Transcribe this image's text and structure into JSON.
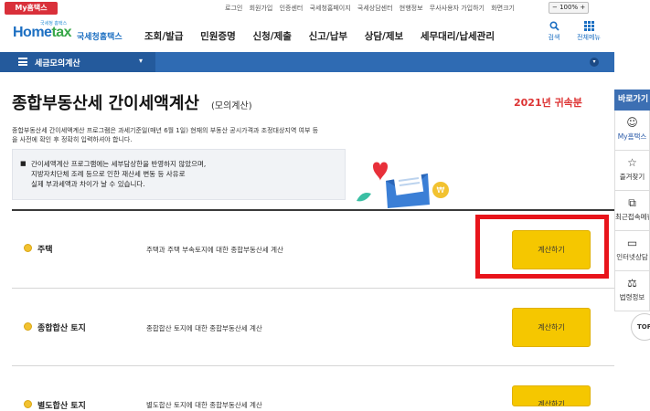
{
  "topbar": {
    "my_tab": "My홈택스",
    "links": [
      "로그인",
      "회원가입",
      "인증센터",
      "국세청홈페이지",
      "국세상담센터",
      "현행정보",
      "무사사용자 가입하기",
      "화면크기"
    ],
    "zoom": "100%"
  },
  "header": {
    "logo_tiny": "국세청 홈택스",
    "logo_home": "Home",
    "logo_tax": "tax",
    "logo_kr": "국세청홈택스",
    "nav": [
      "조회/발급",
      "민원증명",
      "신청/제출",
      "신고/납부",
      "상담/제보",
      "세무대리/납세관리"
    ],
    "search_label": "검색",
    "allmenu_label": "전체메뉴"
  },
  "navbar": {
    "title": "세금모의계산",
    "caret": "▾"
  },
  "main": {
    "title": "종합부동산세 간이세액계산",
    "subtitle": "(모의계산)",
    "year": "2021년 귀속분",
    "description": "종합부동산세 간이세액계산 프로그램은 과세기준일(매년 6월 1일) 현재의 부동산 공시가격과 조정대상지역 여부 등을 사전에 확인 후 정확히 입력하셔야 합니다.",
    "notice_lines": [
      "간이세액계산 프로그램에는 세부담상한을 반영하지 않았으며,",
      "지방자치단체 조례 등으로 인한 재산세 변동 등 사유로",
      "실제 부과세액과 차이가 날 수 있습니다."
    ],
    "rows": [
      {
        "name": "주택",
        "desc": "주택과 주택 부속토지에 대한 종합부동산세 계산",
        "button": "계산하기"
      },
      {
        "name": "종합합산 토지",
        "desc": "종합합산 토지에 대한 종합부동산세 계산",
        "button": "계산하기"
      },
      {
        "name": "별도합산 토지",
        "desc": "별도합산 토지에 대한 종합부동산세 계산",
        "button": "계산하기"
      }
    ]
  },
  "sidebar": {
    "heading": "바로가기",
    "items": [
      {
        "icon": "user-icon",
        "label": "My홈택스"
      },
      {
        "icon": "star-icon",
        "label": "즐겨찾기"
      },
      {
        "icon": "history-icon",
        "label": "최근접속메뉴"
      },
      {
        "icon": "monitor-icon",
        "label": "인터넷상담"
      },
      {
        "icon": "gavel-icon",
        "label": "법령정보"
      }
    ],
    "top_button": "TOP"
  },
  "colors": {
    "accent_blue": "#2f6bb3",
    "button_yellow": "#f5c700",
    "highlight_red": "#e8141b",
    "year_red": "#d33"
  }
}
